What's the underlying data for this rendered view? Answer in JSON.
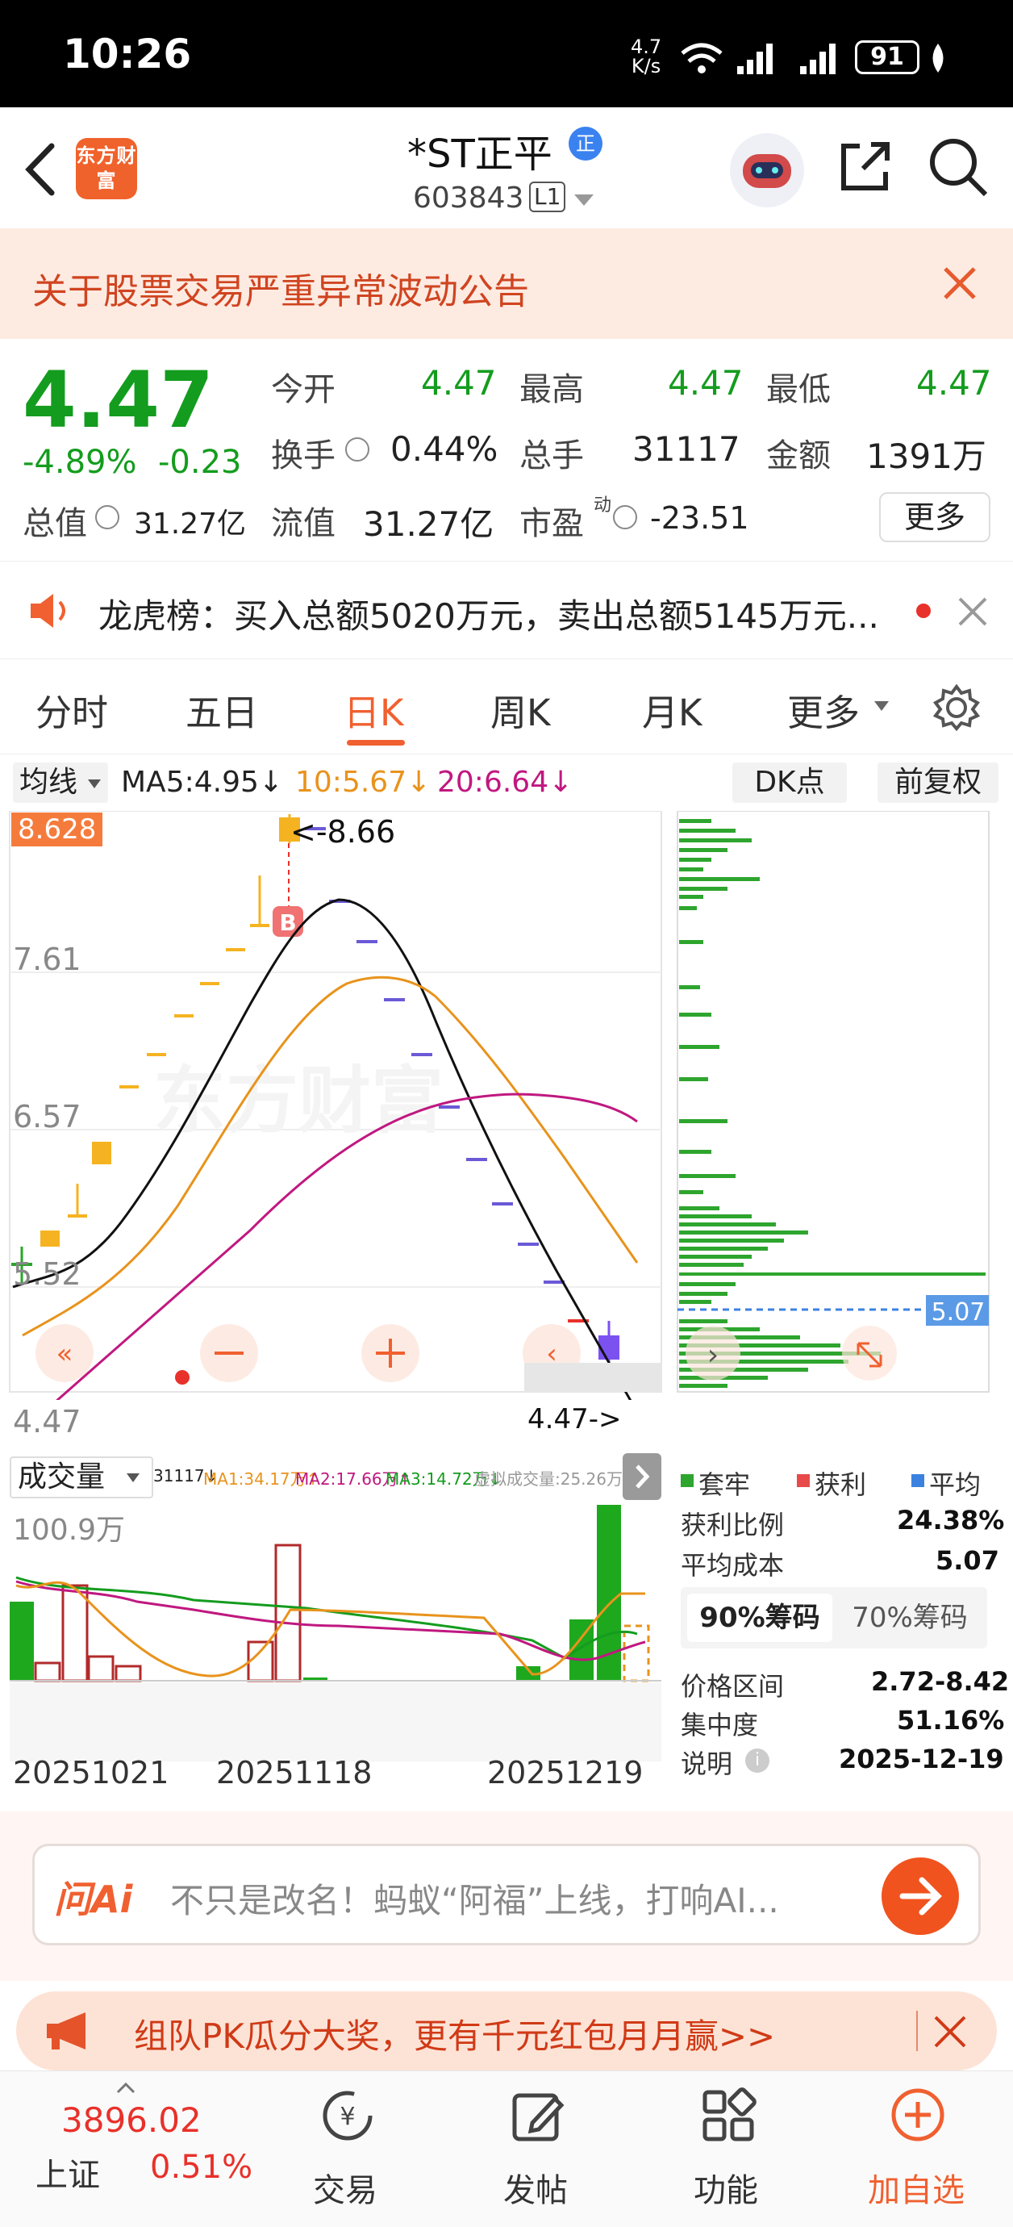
{
  "status_bar": {
    "time": "10:26",
    "net_speed_top": "4.7",
    "net_speed_unit": "K/s",
    "battery": "91"
  },
  "header": {
    "logo_text": "东方财富",
    "stock_name": "*ST正平",
    "badge": "正",
    "code": "603843",
    "level": "L1"
  },
  "notice": {
    "text": "关于股票交易严重异常波动公告"
  },
  "quote": {
    "price": "4.47",
    "change_pct": "-4.89%",
    "change_amt": "-0.23",
    "total_value_label": "总值",
    "total_value": "31.27亿",
    "open_label": "今开",
    "open": "4.47",
    "high_label": "最高",
    "high": "4.47",
    "low_label": "最低",
    "low": "4.47",
    "turnover_label": "换手",
    "turnover": "0.44%",
    "volume_label": "总手",
    "volume": "31117",
    "amount_label": "金额",
    "amount": "1391万",
    "float_label": "流值",
    "float_value": "31.27亿",
    "pe_label": "市盈",
    "pe_sup": "动",
    "pe": "-23.51",
    "more_label": "更多"
  },
  "lhb": {
    "text": "龙虎榜：买入总额5020万元，卖出总额5145万元..."
  },
  "tabs": [
    {
      "label": "分时"
    },
    {
      "label": "五日"
    },
    {
      "label": "日K"
    },
    {
      "label": "周K"
    },
    {
      "label": "月K"
    },
    {
      "label": "更多"
    }
  ],
  "indicator": {
    "select": "均线",
    "ma5": "MA5:4.95↓",
    "ma10": "10:5.67↓",
    "ma20": "20:6.64↓",
    "dk": "DK点",
    "fq": "前复权"
  },
  "kline": {
    "top_price": "8.628",
    "max_marker": "<-8.66",
    "current_marker": "4.47->",
    "y_ticks": [
      "7.61",
      "6.57",
      "5.52",
      "4.47"
    ],
    "watermark": "东方财富",
    "buy_marker": "B"
  },
  "volume": {
    "select": "成交量",
    "vol": "31117↓",
    "ma1": "MA1:34.17万↑",
    "ma2": "MA2:17.66万↑",
    "ma3": "MA3:14.72万↓",
    "virtual": "虚拟成交量:25.26万",
    "max": "100.9万",
    "dates": [
      "20251021",
      "20251118",
      "20251219"
    ]
  },
  "chips": {
    "avg_price": "5.07",
    "legend": [
      {
        "label": "套牢",
        "color": "#2ea52e"
      },
      {
        "label": "获利",
        "color": "#e84a4a"
      },
      {
        "label": "平均",
        "color": "#3b82e0"
      }
    ],
    "profit_ratio_label": "获利比例",
    "profit_ratio": "24.38%",
    "avg_cost_label": "平均成本",
    "avg_cost": "5.07",
    "tab90": "90%筹码",
    "tab70": "70%筹码",
    "range_label": "价格区间",
    "range": "2.72-8.42",
    "conc_label": "集中度",
    "conc": "51.16%",
    "note_label": "说明",
    "note_date": "2025-12-19"
  },
  "ai": {
    "logo": "问Ai",
    "text": "不只是改名！蚂蚁“阿福”上线，打响AI..."
  },
  "promo": {
    "text": "组队PK瓜分大奖，更有千元红包月月赢>>"
  },
  "bottom_nav": {
    "index_value": "3896.02",
    "index_name": "上证",
    "index_pct": "0.51%",
    "items": [
      {
        "label": "交易"
      },
      {
        "label": "发帖"
      },
      {
        "label": "功能"
      },
      {
        "label": "加自选"
      }
    ]
  },
  "chart_data": {
    "type": "candlestick",
    "y_ticks": [
      "7.61",
      "6.57",
      "5.52",
      "4.47"
    ],
    "ylim": [
      4.47,
      8.628
    ],
    "x_ticks": [
      "20251021",
      "20251118",
      "20251219"
    ],
    "series": [
      {
        "name": "MA5",
        "value": 4.95
      },
      {
        "name": "MA10",
        "value": 5.67
      },
      {
        "name": "MA20",
        "value": 6.64
      }
    ],
    "volume_max": "100.9万"
  }
}
